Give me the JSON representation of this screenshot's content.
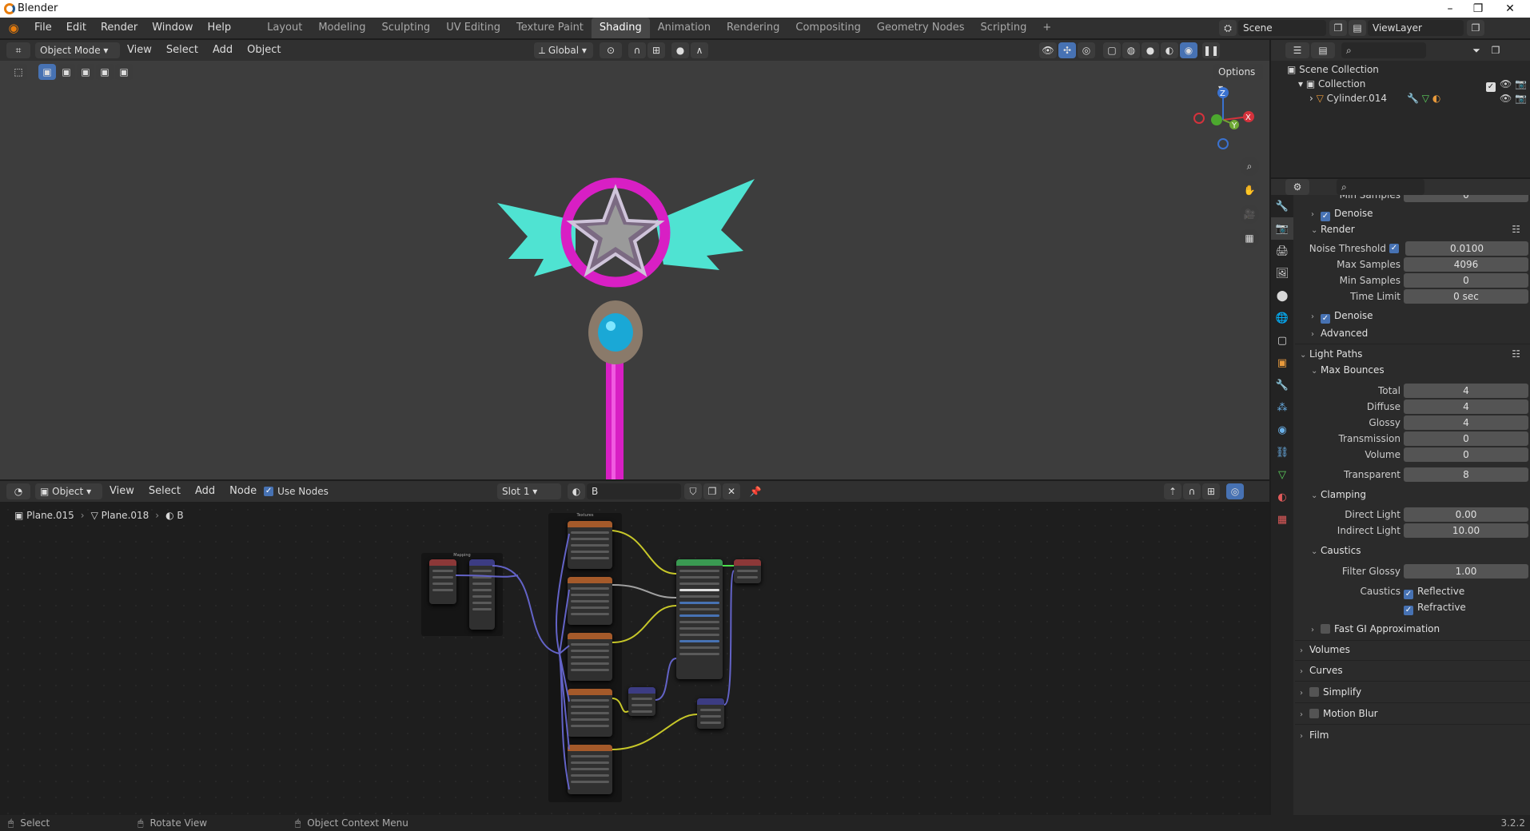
{
  "window": {
    "title": "Blender",
    "minimize": "–",
    "maximize": "❐",
    "close": "✕"
  },
  "menubar": {
    "items": [
      "File",
      "Edit",
      "Render",
      "Window",
      "Help"
    ]
  },
  "workspaces": {
    "tabs": [
      "Layout",
      "Modeling",
      "Sculpting",
      "UV Editing",
      "Texture Paint",
      "Shading",
      "Animation",
      "Rendering",
      "Compositing",
      "Geometry Nodes",
      "Scripting"
    ],
    "active": "Shading",
    "add": "+"
  },
  "scene": {
    "name": "Scene",
    "view_layer": "ViewLayer"
  },
  "viewport_header": {
    "mode": "Object Mode",
    "menus": [
      "View",
      "Select",
      "Add",
      "Object"
    ],
    "transform_orientation": "Global",
    "options": "Options"
  },
  "navigation_gizmo": {
    "x": "X",
    "y": "Y",
    "z": "Z"
  },
  "node_header": {
    "editor_type": "Object",
    "menus": [
      "View",
      "Select",
      "Add",
      "Node"
    ],
    "use_nodes_label": "Use Nodes",
    "use_nodes": true,
    "slot": "Slot 1",
    "material": "B"
  },
  "breadcrumb": {
    "object": "Plane.015",
    "mesh": "Plane.018",
    "material": "B"
  },
  "nodes": {
    "mapping_frame": "Mapping",
    "textures_frame": "Textures"
  },
  "outliner": {
    "scene_collection": "Scene Collection",
    "collection": "Collection",
    "object": "Cylinder.014"
  },
  "properties": {
    "partial_top": {
      "label": "Min Samples",
      "value": "0"
    },
    "denoise_1": "Denoise",
    "render": "Render",
    "noise_threshold": {
      "label": "Noise Threshold",
      "value": "0.0100"
    },
    "max_samples": {
      "label": "Max Samples",
      "value": "4096"
    },
    "min_samples": {
      "label": "Min Samples",
      "value": "0"
    },
    "time_limit": {
      "label": "Time Limit",
      "value": "0 sec"
    },
    "denoise_2": "Denoise",
    "advanced": "Advanced",
    "light_paths": "Light Paths",
    "max_bounces": "Max Bounces",
    "total": {
      "label": "Total",
      "value": "4"
    },
    "diffuse": {
      "label": "Diffuse",
      "value": "4"
    },
    "glossy": {
      "label": "Glossy",
      "value": "4"
    },
    "transmission": {
      "label": "Transmission",
      "value": "0"
    },
    "volume": {
      "label": "Volume",
      "value": "0"
    },
    "transparent": {
      "label": "Transparent",
      "value": "8"
    },
    "clamping": "Clamping",
    "direct_light": {
      "label": "Direct Light",
      "value": "0.00"
    },
    "indirect_light": {
      "label": "Indirect Light",
      "value": "10.00"
    },
    "caustics": "Caustics",
    "filter_glossy": {
      "label": "Filter Glossy",
      "value": "1.00"
    },
    "caustics_label": "Caustics",
    "reflective": "Reflective",
    "refractive": "Refractive",
    "fast_gi": "Fast GI Approximation",
    "volumes": "Volumes",
    "curves": "Curves",
    "simplify": "Simplify",
    "motion_blur": "Motion Blur",
    "film": "Film"
  },
  "status": {
    "select": "Select",
    "rotate": "Rotate View",
    "context_menu": "Object Context Menu",
    "version": "3.2.2"
  },
  "colors": {
    "accent": "#4772b3",
    "header": "#303030",
    "viewport": "#3d3d3d",
    "wand_pink": "#d81fc4",
    "wing_cyan": "#4fe3d2"
  }
}
